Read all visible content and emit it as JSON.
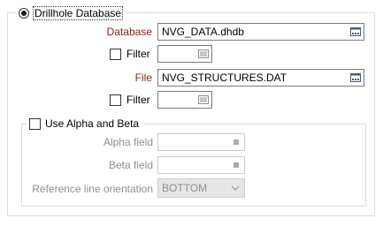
{
  "source_option": {
    "label": "Drillhole Database",
    "selected": true
  },
  "database": {
    "label": "Database",
    "value": "NVG_DATA.dhdb",
    "browse_icon": "browse-icon"
  },
  "database_filter": {
    "label": "Filter",
    "checked": false,
    "value": "",
    "icon": "filter-list-icon"
  },
  "file": {
    "label": "File",
    "value": "NVG_STRUCTURES.DAT",
    "browse_icon": "browse-icon"
  },
  "file_filter": {
    "label": "Filter",
    "checked": false,
    "value": "",
    "icon": "filter-list-icon"
  },
  "alpha_beta": {
    "label": "Use Alpha and Beta",
    "checked": false,
    "alpha_field_label": "Alpha field",
    "alpha_field_value": "",
    "beta_field_label": "Beta field",
    "beta_field_value": "",
    "reference_label": "Reference line orientation",
    "reference_value": "BOTTOM"
  },
  "colors": {
    "required_label": "#8b1c1c",
    "disabled_text": "#8f8f8f",
    "field_border": "#7a7a7a",
    "group_border": "#dcdcdc"
  }
}
